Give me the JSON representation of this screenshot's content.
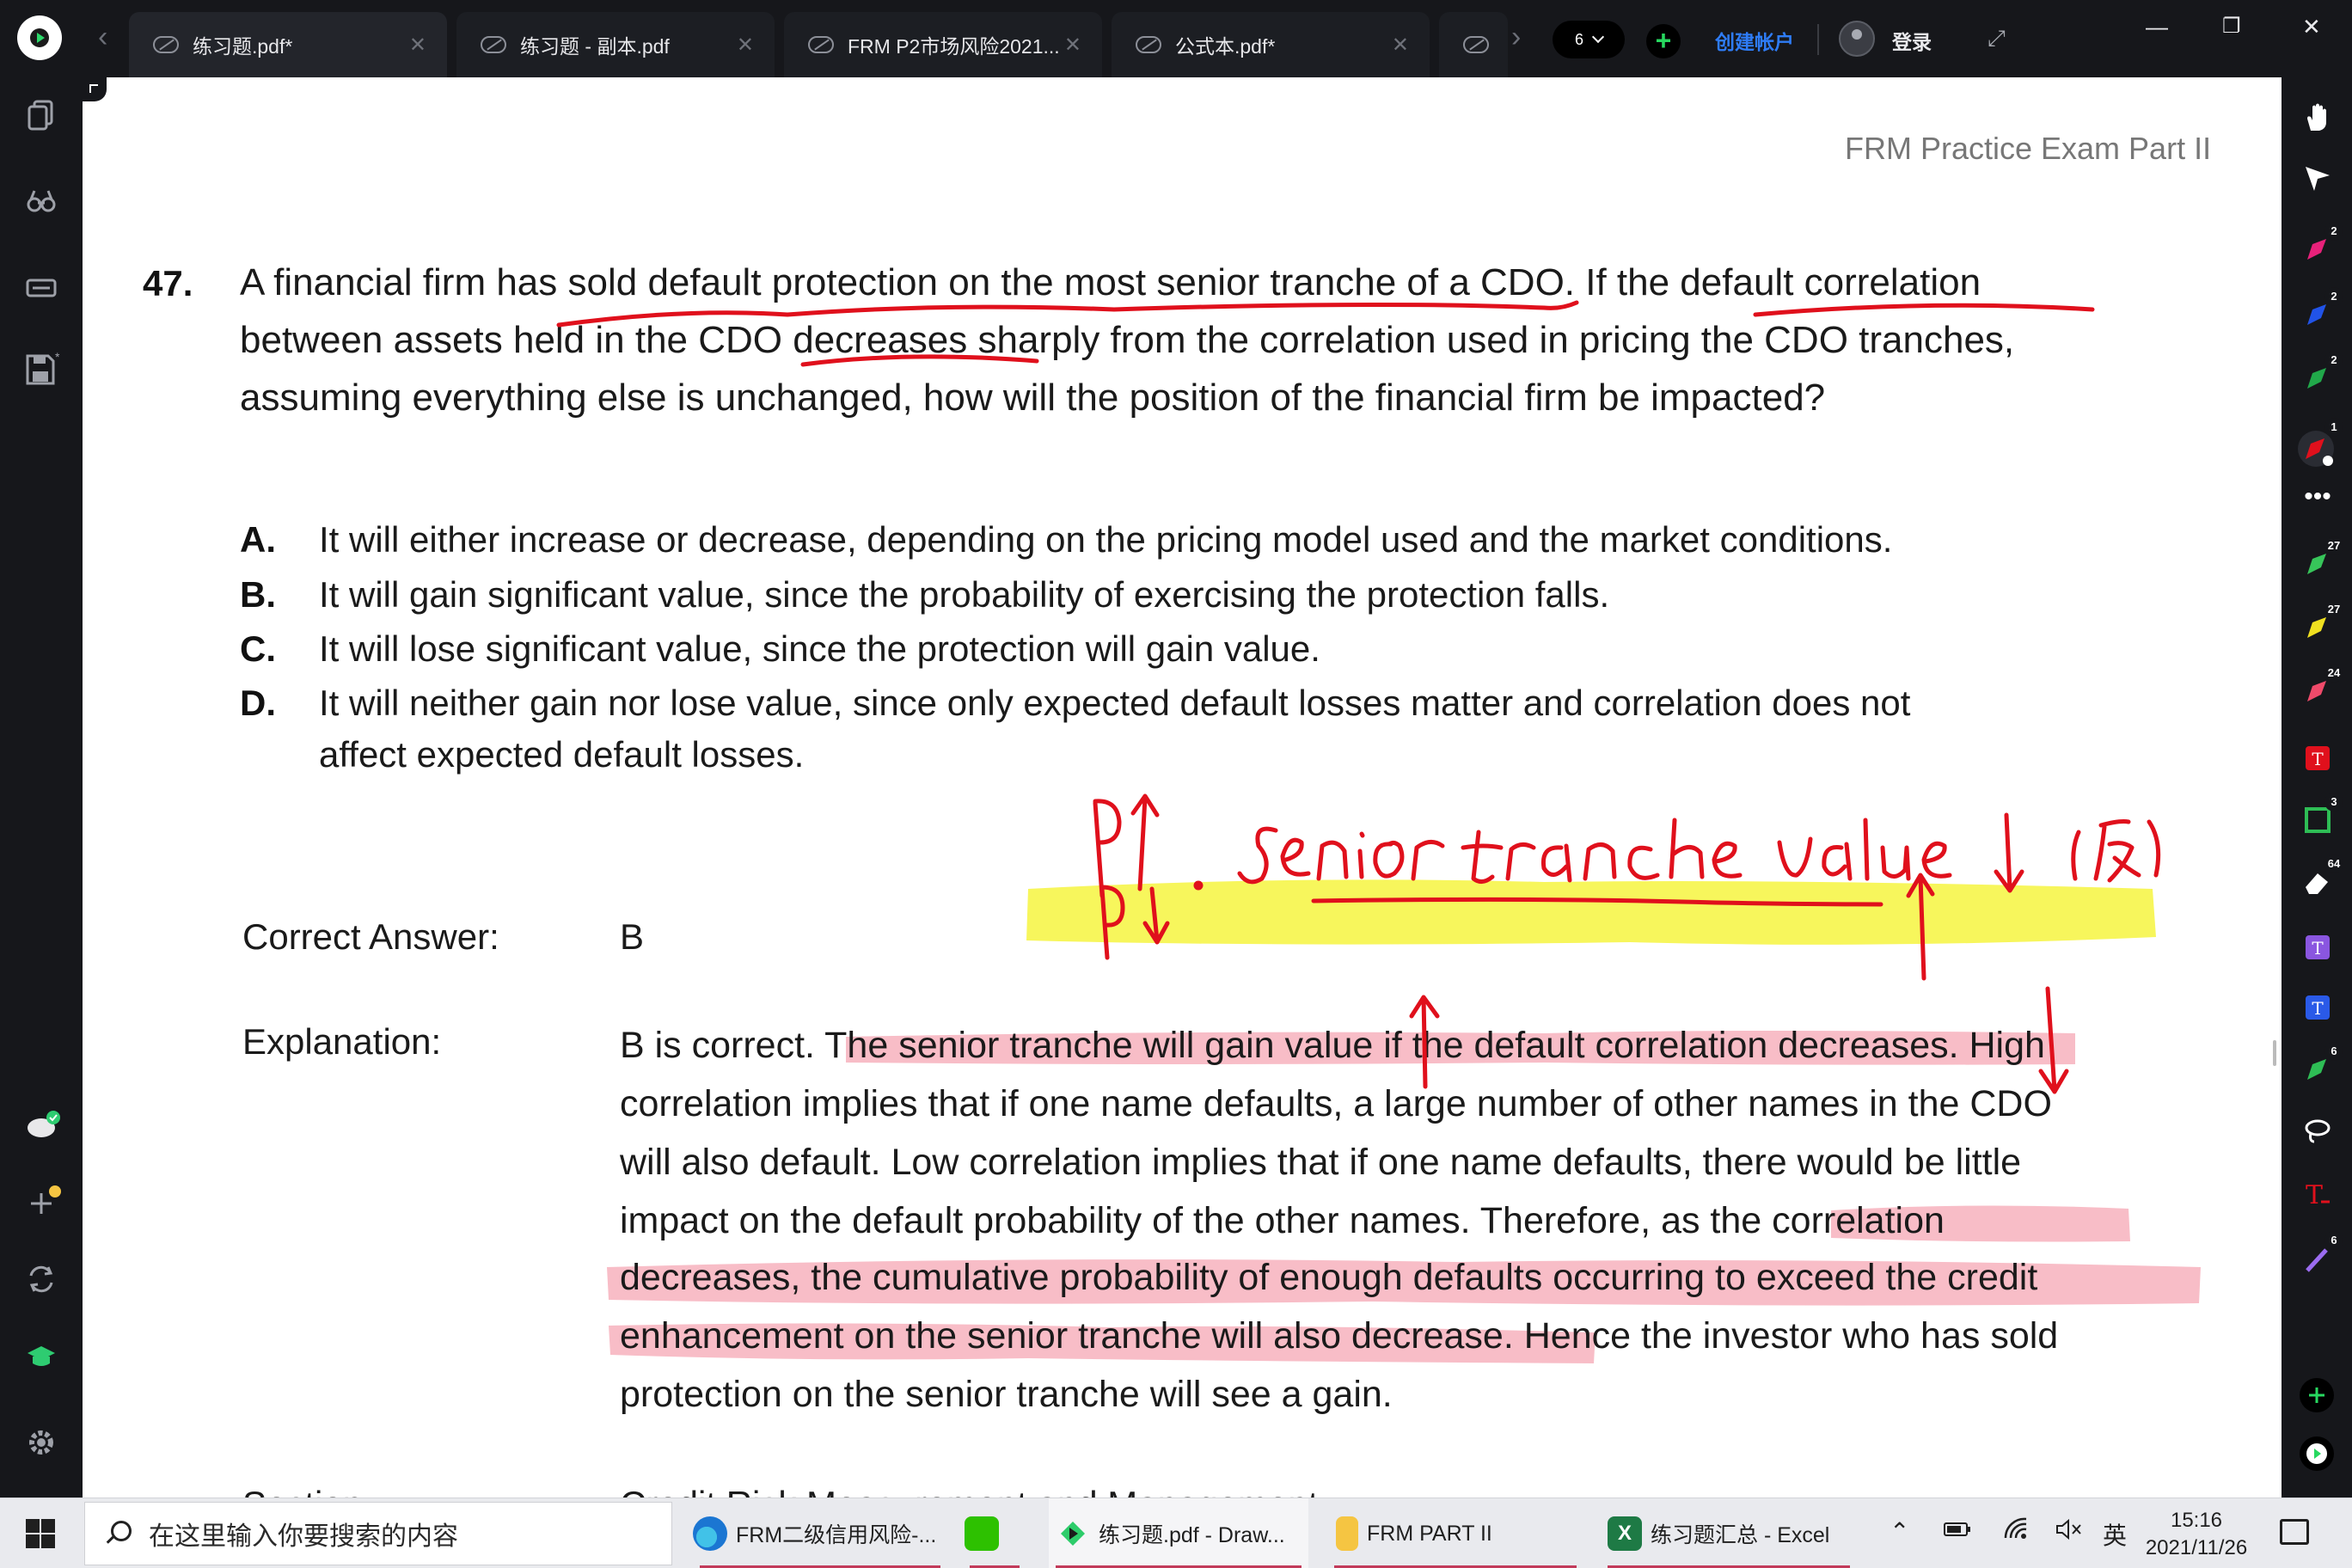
{
  "tabs": [
    {
      "label": "练习题.pdf*",
      "active": true
    },
    {
      "label": "练习题 - 副本.pdf",
      "active": false
    },
    {
      "label": "FRM P2市场风险2021...",
      "active": false
    },
    {
      "label": "公式本.pdf*",
      "active": false
    }
  ],
  "titlebar": {
    "page_count": "6",
    "create_account": "创建帐户",
    "login": "登录",
    "add_tab": "+"
  },
  "document": {
    "header": "FRM Practice Exam Part II",
    "question_number": "47.",
    "question_lines": [
      "A financial firm has sold default protection on the most senior tranche of a CDO. If the default correlation",
      "between assets held in the CDO decreases sharply from the correlation used in pricing the CDO tranches,",
      "assuming everything else is unchanged, how will the position of the financial firm be impacted?"
    ],
    "options": [
      {
        "letter": "A.",
        "text": "It will either increase or decrease, depending on the pricing model used and the market conditions."
      },
      {
        "letter": "B.",
        "text": "It will gain significant value, since the probability of exercising the protection falls."
      },
      {
        "letter": "C.",
        "text": "It will lose significant value, since the protection will gain value."
      },
      {
        "letter": "D.",
        "text": "It will neither gain nor lose value, since only expected default losses matter and correlation does not"
      }
    ],
    "option_d_continuation": "affect expected default losses.",
    "correct_answer_label": "Correct Answer:",
    "correct_answer": "B",
    "explanation_label": "Explanation:",
    "explanation_lines": [
      "B is correct. The senior tranche will gain value if the default correlation decreases. High",
      "correlation implies that if one name defaults, a large number of other names in the CDO",
      "will also default. Low correlation implies that if one name defaults, there would be little",
      "impact on the default probability of the other names. Therefore, as the correlation",
      "decreases, the cumulative probability of enough defaults occurring to exceed the credit",
      "enhancement on the senior tranche will also decrease. Hence the investor who has sold",
      "protection on the senior tranche will see a gain."
    ],
    "section_label": "Section:",
    "section_value": "Credit Risk Measurement and Management"
  },
  "annotations": {
    "handwritten_line1": "ρ↑. senior tranche value ↓  (反)",
    "handwritten_line2": "ρ↓ ————— ↑",
    "ink_color": "#e0101c",
    "highlight_yellow": "#f6f54a",
    "highlight_pink": "#f7b6c1"
  },
  "right_rail_badges": [
    "2",
    "2",
    "2",
    "1",
    "27",
    "27",
    "24",
    "3",
    "64",
    "6",
    "6"
  ],
  "taskbar": {
    "search_placeholder": "在这里输入你要搜索的内容",
    "items": [
      {
        "label": "FRM二级信用风险-..."
      },
      {
        "label": ""
      },
      {
        "label": "练习题.pdf - Draw..."
      },
      {
        "label": "FRM PART II"
      },
      {
        "label": "练习题汇总 - Excel"
      }
    ],
    "ime": "英",
    "time": "15:16",
    "date": "2021/11/26"
  }
}
